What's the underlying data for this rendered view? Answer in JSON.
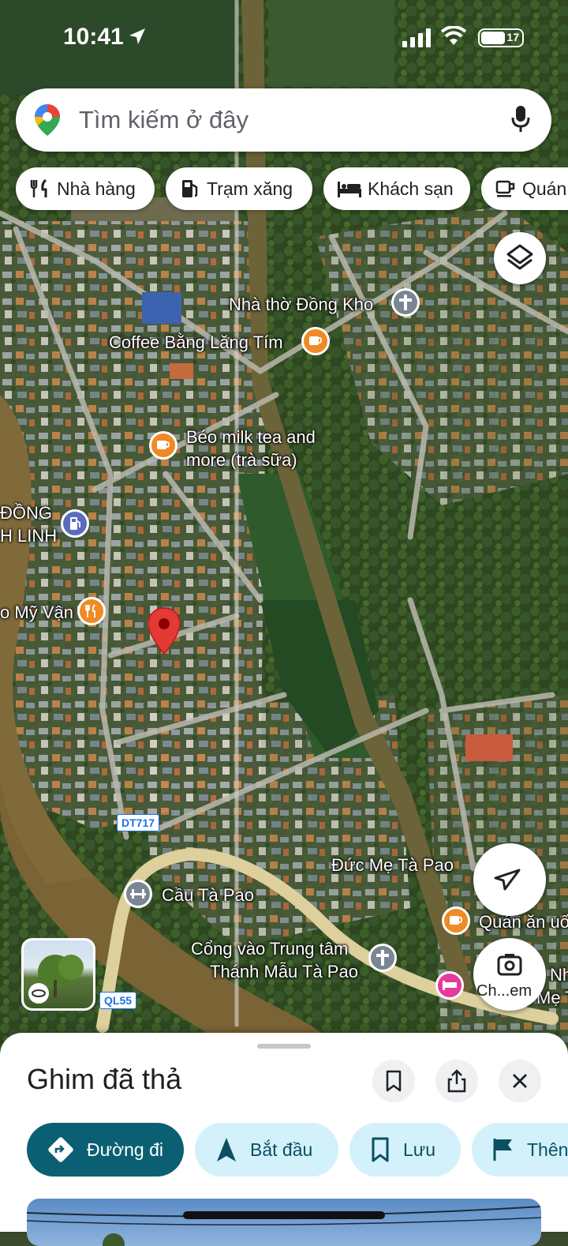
{
  "status_bar": {
    "time": "10:41",
    "battery": "17"
  },
  "search": {
    "placeholder": "Tìm kiếm ở đây"
  },
  "chips": [
    {
      "label": "Nhà hàng",
      "icon": "fork-knife-icon"
    },
    {
      "label": "Trạm xăng",
      "icon": "gas-pump-icon"
    },
    {
      "label": "Khách sạn",
      "icon": "bed-icon"
    },
    {
      "label": "Quán",
      "icon": "cup-icon"
    }
  ],
  "map": {
    "labels": {
      "church_dong_kho": "Nhà thờ Đồng Kho",
      "coffee": "Coffee Bằng Lăng Tím",
      "milk_tea_1": "Béo milk tea and",
      "milk_tea_2": "more (trà sữa)",
      "gas_1": "ĐỒNG",
      "gas_2": "H LINH",
      "restaurant": "o Mỹ Vận",
      "duc_me": "Đức Mẹ Tà Pao",
      "bridge": "Cầu Tà Pao",
      "gate_1": "Cổng vào Trung tâm",
      "gate_2": "Thánh Mẫu Tà Pao",
      "quan_an": "Quán ăn uố",
      "right_1": "Nh",
      "right_2": "Mẹ Tà"
    },
    "road_shields": {
      "dt717": "DT717",
      "ql55": "QL55"
    },
    "camera_label": "Ch...em"
  },
  "sheet": {
    "title": "Ghim đã thả",
    "actions": [
      {
        "label": "Đường đi",
        "icon": "directions-icon"
      },
      {
        "label": "Bắt đầu",
        "icon": "navigation-arrow-icon"
      },
      {
        "label": "Lưu",
        "icon": "bookmark-icon"
      },
      {
        "label": "Thên",
        "icon": "flag-icon"
      }
    ]
  },
  "colors": {
    "primary": "#0b5f73",
    "light_action": "#d3f1fa",
    "pin": "#e53935",
    "poi_orange": "#f08a24",
    "poi_gray": "#7a8694",
    "poi_blue": "#5c6bc0",
    "poi_pink": "#e63b9a"
  }
}
